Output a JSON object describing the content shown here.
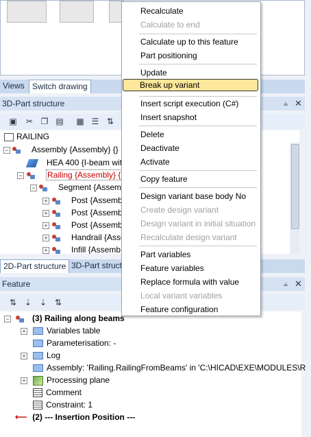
{
  "tabs_top": [
    "Views",
    "Switch drawing"
  ],
  "panel_3d": {
    "title": "3D-Part structure",
    "pin": "⫨",
    "close": "✕"
  },
  "tree3d": [
    {
      "label": "RAILING"
    },
    {
      "label": "Assembly {Assembly} {}"
    },
    {
      "label": "HEA 400 {I-beam wit"
    },
    {
      "label": "Railing {Assembly} {"
    },
    {
      "label": "Segment {Assem"
    },
    {
      "label": "Post {Assemb"
    },
    {
      "label": "Post {Assemb"
    },
    {
      "label": "Post {Assemb"
    },
    {
      "label": "Handrail {Assem"
    },
    {
      "label": "Infill {Assemb"
    }
  ],
  "tabs_mid": [
    "2D-Part structure",
    "3D-Part structu"
  ],
  "panel_feature": {
    "title": "Feature",
    "pin": "⫨",
    "close": "✕"
  },
  "feature_tree": [
    {
      "label": "(3) Railing along beams"
    },
    {
      "label": "Variables table"
    },
    {
      "label": "Parameterisation: -"
    },
    {
      "label": "Log"
    },
    {
      "label": "Assembly: 'Railing.RailingFromBeams' in 'C:\\HICAD\\EXE\\MODULES\\R"
    },
    {
      "label": "Processing plane"
    },
    {
      "label": "Comment"
    },
    {
      "label": "Constraint: 1"
    },
    {
      "label": "(2) --- Insertion Position ---"
    }
  ],
  "context_menu": [
    {
      "label": "Recalculate",
      "enabled": true
    },
    {
      "label": "Calculate to end",
      "enabled": false
    },
    {
      "label": "Calculate up to this feature",
      "enabled": true
    },
    {
      "label": "Part positioning",
      "enabled": true
    },
    {
      "label": "Update",
      "enabled": true
    },
    {
      "label": "Break up variant",
      "enabled": true,
      "highlighted": true
    },
    {
      "label": "Insert script execution (C#)",
      "enabled": true
    },
    {
      "label": "Insert snapshot",
      "enabled": true
    },
    {
      "label": "Delete",
      "enabled": true
    },
    {
      "label": "Deactivate",
      "enabled": true
    },
    {
      "label": "Activate",
      "enabled": true
    },
    {
      "label": "Copy feature",
      "enabled": true
    },
    {
      "label": "Design variant base body No",
      "enabled": true
    },
    {
      "label": "Create design variant",
      "enabled": false
    },
    {
      "label": "Design variant in initial situation",
      "enabled": false
    },
    {
      "label": "Recalculate design variant",
      "enabled": false
    },
    {
      "label": "Part variables",
      "enabled": true
    },
    {
      "label": "Feature variables",
      "enabled": true
    },
    {
      "label": "Replace formula with value",
      "enabled": true
    },
    {
      "label": "Local variant variables",
      "enabled": false
    },
    {
      "label": "Feature configuration",
      "enabled": true
    }
  ],
  "colors": {
    "highlight": "#fde79b",
    "selected_text": "#c00000",
    "arrow": "#d01010"
  }
}
